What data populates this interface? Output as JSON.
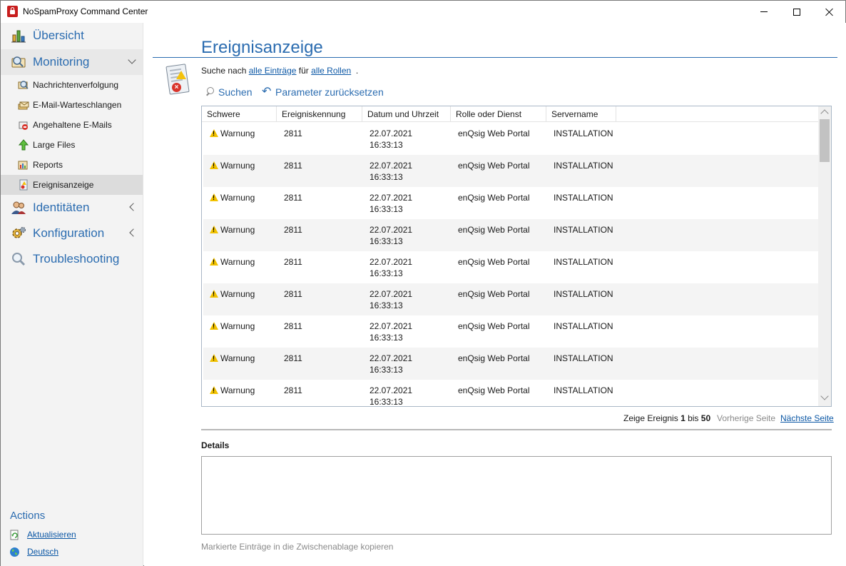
{
  "window": {
    "title": "NoSpamProxy Command Center"
  },
  "sidebar": {
    "overview": "Übersicht",
    "monitoring": "Monitoring",
    "monitoring_items": [
      {
        "label": "Nachrichtenverfolgung",
        "icon": "message-tracking-icon"
      },
      {
        "label": "E-Mail-Warteschlangen",
        "icon": "email-queue-icon"
      },
      {
        "label": "Angehaltene E-Mails",
        "icon": "held-emails-icon"
      },
      {
        "label": "Large Files",
        "icon": "large-files-icon"
      },
      {
        "label": "Reports",
        "icon": "reports-icon"
      },
      {
        "label": "Ereignisanzeige",
        "icon": "event-viewer-icon"
      }
    ],
    "identities": "Identitäten",
    "configuration": "Konfiguration",
    "troubleshooting": "Troubleshooting"
  },
  "actions": {
    "title": "Actions",
    "refresh": "Aktualisieren",
    "language": "Deutsch"
  },
  "page": {
    "title": "Ereignisanzeige",
    "search_prefix": "Suche nach",
    "search_entries": "alle Einträge",
    "search_for": "für",
    "search_roles": "alle Rollen",
    "search_end": ".",
    "search_button": "Suchen",
    "reset_button": "Parameter zurücksetzen"
  },
  "table": {
    "columns": [
      "Schwere",
      "Ereigniskennung",
      "Datum und Uhrzeit",
      "Rolle oder Dienst",
      "Servername"
    ],
    "rows": [
      {
        "severity": "Warnung",
        "id": "2811",
        "date": "22.07.2021",
        "time": "16:33:13",
        "role": "enQsig Web Portal",
        "server": "INSTALLATION"
      },
      {
        "severity": "Warnung",
        "id": "2811",
        "date": "22.07.2021",
        "time": "16:33:13",
        "role": "enQsig Web Portal",
        "server": "INSTALLATION"
      },
      {
        "severity": "Warnung",
        "id": "2811",
        "date": "22.07.2021",
        "time": "16:33:13",
        "role": "enQsig Web Portal",
        "server": "INSTALLATION"
      },
      {
        "severity": "Warnung",
        "id": "2811",
        "date": "22.07.2021",
        "time": "16:33:13",
        "role": "enQsig Web Portal",
        "server": "INSTALLATION"
      },
      {
        "severity": "Warnung",
        "id": "2811",
        "date": "22.07.2021",
        "time": "16:33:13",
        "role": "enQsig Web Portal",
        "server": "INSTALLATION"
      },
      {
        "severity": "Warnung",
        "id": "2811",
        "date": "22.07.2021",
        "time": "16:33:13",
        "role": "enQsig Web Portal",
        "server": "INSTALLATION"
      },
      {
        "severity": "Warnung",
        "id": "2811",
        "date": "22.07.2021",
        "time": "16:33:13",
        "role": "enQsig Web Portal",
        "server": "INSTALLATION"
      },
      {
        "severity": "Warnung",
        "id": "2811",
        "date": "22.07.2021",
        "time": "16:33:13",
        "role": "enQsig Web Portal",
        "server": "INSTALLATION"
      },
      {
        "severity": "Warnung",
        "id": "2811",
        "date": "22.07.2021",
        "time": "16:33:13",
        "role": "enQsig Web Portal",
        "server": "INSTALLATION"
      }
    ]
  },
  "pager": {
    "info_prefix": "Zeige Ereignis",
    "from": "1",
    "info_mid": "bis",
    "to": "50",
    "prev": "Vorherige Seite",
    "next": "Nächste Seite"
  },
  "details": {
    "title": "Details",
    "copy_hint": "Markierte Einträge in die Zwischenablage kopieren"
  }
}
